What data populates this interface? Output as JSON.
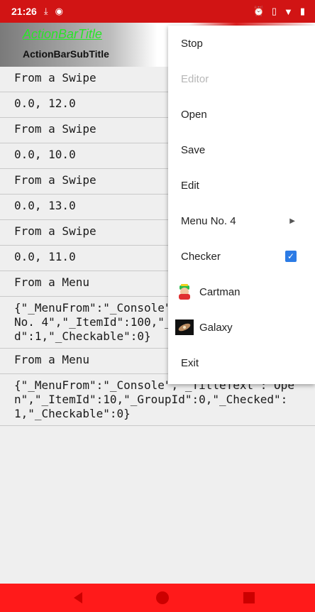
{
  "status_bar": {
    "time": "21:26",
    "left_icons": [
      "download-icon",
      "chrome-icon"
    ],
    "right_icons": [
      "alarm-icon",
      "vibrate-icon",
      "wifi-icon",
      "battery-icon"
    ]
  },
  "action_bar": {
    "title": "ActionBarTitle",
    "subtitle": "ActionBarSubTitle"
  },
  "list": {
    "rows": [
      "From a Swipe",
      "0.0, 12.0",
      "From a Swipe",
      "0.0, 10.0",
      "From a Swipe",
      "0.0, 13.0",
      "From a Swipe",
      "0.0, 11.0",
      "From a Menu",
      "{\"_MenuFrom\":\"_Console\",\"_TitleText\":\"Menu No. 4\",\"_ItemId\":100,\"_GroupId\":0,\"_Checked\":1,\"_Checkable\":0}",
      "From a Menu",
      "{\"_MenuFrom\":\"_Console\",\"_TitleText\":\"Open\",\"_ItemId\":10,\"_GroupId\":0,\"_Checked\":1,\"_Checkable\":0}"
    ]
  },
  "menu": {
    "items": [
      {
        "label": "Stop"
      },
      {
        "label": "Editor",
        "disabled": true
      },
      {
        "label": "Open"
      },
      {
        "label": "Save"
      },
      {
        "label": "Edit"
      },
      {
        "label": "Menu No. 4",
        "submenu": true
      },
      {
        "label": "Checker",
        "checked": true
      },
      {
        "label": "Cartman",
        "icon": "cartman-icon"
      },
      {
        "label": "Galaxy",
        "icon": "galaxy-icon"
      },
      {
        "label": "Exit"
      }
    ]
  },
  "colors": {
    "status_bar": "#d11414",
    "nav_bar": "#ff1a1a",
    "title_green": "#29e629",
    "check_blue": "#2c7be5"
  }
}
